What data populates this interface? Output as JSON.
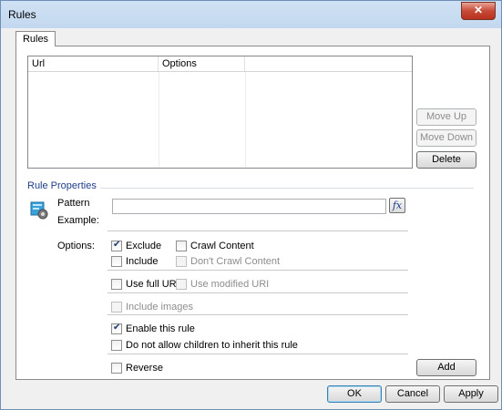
{
  "window": {
    "title": "Rules",
    "close_symbol": "✕"
  },
  "tab": {
    "label": "Rules"
  },
  "list": {
    "columns": [
      "Url",
      "Options",
      ""
    ]
  },
  "side_buttons": {
    "move_up": "Move Up",
    "move_down": "Move Down",
    "delete": "Delete",
    "add": "Add"
  },
  "rule_properties": {
    "title": "Rule Properties",
    "pattern_label": "Pattern",
    "pattern_value": "",
    "fx_label": "fx",
    "example_label": "Example:",
    "options_label": "Options:"
  },
  "options": {
    "exclude": {
      "label": "Exclude",
      "checked": true,
      "enabled": true
    },
    "crawl_content": {
      "label": "Crawl Content",
      "checked": false,
      "enabled": true
    },
    "include": {
      "label": "Include",
      "checked": false,
      "enabled": true
    },
    "dont_crawl_content": {
      "label": "Don't Crawl Content",
      "checked": false,
      "enabled": false
    },
    "use_full_uri": {
      "label": "Use full URI",
      "checked": false,
      "enabled": true
    },
    "use_modified_uri": {
      "label": "Use modified URI",
      "checked": false,
      "enabled": false
    },
    "include_images": {
      "label": "Include images",
      "checked": false,
      "enabled": false
    },
    "enable_rule": {
      "label": "Enable this rule",
      "checked": true,
      "enabled": true
    },
    "no_inherit": {
      "label": "Do not allow children to inherit this rule",
      "checked": false,
      "enabled": true
    },
    "reverse": {
      "label": "Reverse",
      "checked": false,
      "enabled": true
    }
  },
  "footer": {
    "ok": "OK",
    "cancel": "Cancel",
    "apply": "Apply"
  },
  "colors": {
    "group_title": "#1e3e8c",
    "title_gradient": "#cfe1f4",
    "close_button": "#c74a36"
  }
}
